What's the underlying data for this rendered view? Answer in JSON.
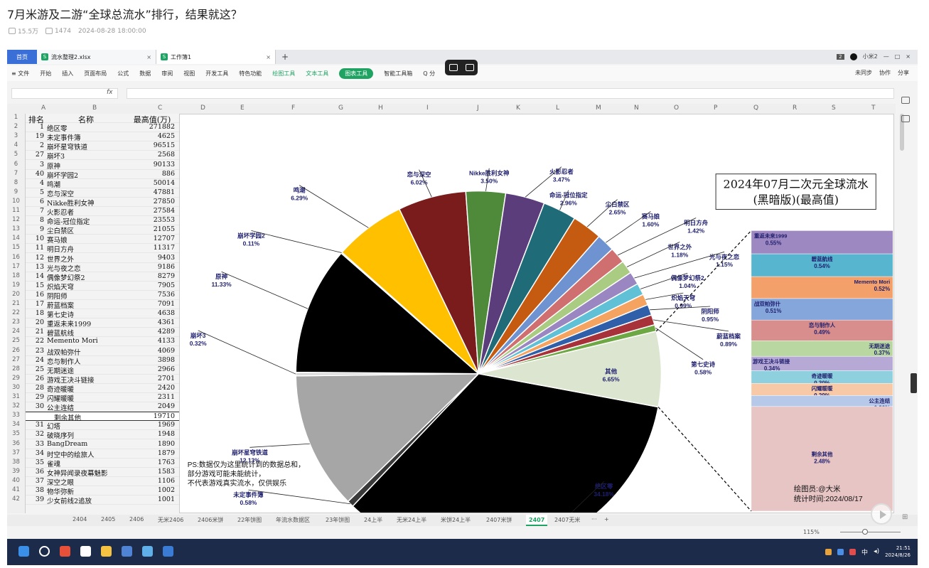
{
  "article": {
    "title": "7月米游及二游“全球总流水”排行，结果就这？",
    "views": "15.5万",
    "comments": "1474",
    "date": "2024-08-28 18:00:00"
  },
  "wps": {
    "home_tab": "首页",
    "doc_tabs": [
      {
        "label": "流水整理2.xlsx",
        "icon": "S"
      },
      {
        "label": "工作簿1",
        "icon": "S"
      }
    ],
    "user": "小米2",
    "page_badge": "2",
    "menu": [
      "≡ 文件",
      "开始",
      "插入",
      "页面布局",
      "公式",
      "数据",
      "审阅",
      "视图",
      "开发工具",
      "特色功能",
      "绘图工具",
      "文本工具",
      "图表工具",
      "智能工具箱",
      "Q 分"
    ],
    "ribbon_right": [
      "未同步",
      "协作",
      "分享"
    ],
    "fx": "fx"
  },
  "sheet": {
    "columns": [
      "A",
      "B",
      "C",
      "D",
      "E",
      "F",
      "G",
      "H",
      "I",
      "J",
      "K",
      "L",
      "M",
      "N",
      "O",
      "P",
      "Q",
      "R",
      "S",
      "T"
    ],
    "header": {
      "rank": "排名",
      "name": "名称",
      "value": "最高值(万)"
    },
    "rows": [
      {
        "rank": "1",
        "name": "绝区零",
        "value": "271882"
      },
      {
        "rank": "19",
        "name": "未定事件簿",
        "value": "4625"
      },
      {
        "rank": "2",
        "name": "崩坏星穹铁道",
        "value": "96515"
      },
      {
        "rank": "27",
        "name": "崩坏3",
        "value": "2568"
      },
      {
        "rank": "3",
        "name": "原神",
        "value": "90133"
      },
      {
        "rank": "40",
        "name": "崩坏学园2",
        "value": "886"
      },
      {
        "rank": "4",
        "name": "鸣潮",
        "value": "50014"
      },
      {
        "rank": "5",
        "name": "恋与深空",
        "value": "47881"
      },
      {
        "rank": "6",
        "name": "Nikke胜利女神",
        "value": "27850"
      },
      {
        "rank": "7",
        "name": "火影忍者",
        "value": "27584"
      },
      {
        "rank": "8",
        "name": "命运-冠位指定",
        "value": "23553"
      },
      {
        "rank": "9",
        "name": "尘白禁区",
        "value": "21055"
      },
      {
        "rank": "10",
        "name": "赛马娘",
        "value": "12707"
      },
      {
        "rank": "11",
        "name": "明日方舟",
        "value": "11317"
      },
      {
        "rank": "12",
        "name": "世界之外",
        "value": "9403"
      },
      {
        "rank": "13",
        "name": "光与夜之恋",
        "value": "9186"
      },
      {
        "rank": "14",
        "name": "偶像梦幻祭2",
        "value": "8279"
      },
      {
        "rank": "15",
        "name": "炽焰天穹",
        "value": "7905"
      },
      {
        "rank": "16",
        "name": "阴阳师",
        "value": "7536"
      },
      {
        "rank": "17",
        "name": "蔚蓝档案",
        "value": "7091"
      },
      {
        "rank": "18",
        "name": "第七史诗",
        "value": "4638"
      },
      {
        "rank": "20",
        "name": "重返未来1999",
        "value": "4361"
      },
      {
        "rank": "21",
        "name": "碧蓝航线",
        "value": "4289"
      },
      {
        "rank": "22",
        "name": "Memento Mori",
        "value": "4133"
      },
      {
        "rank": "23",
        "name": "战双帕弥什",
        "value": "4069"
      },
      {
        "rank": "24",
        "name": "恋与制作人",
        "value": "3898"
      },
      {
        "rank": "25",
        "name": "无期迷途",
        "value": "2966"
      },
      {
        "rank": "26",
        "name": "游戏王决斗链接",
        "value": "2701"
      },
      {
        "rank": "28",
        "name": "奇迹暖暖",
        "value": "2420"
      },
      {
        "rank": "29",
        "name": "闪耀暖暖",
        "value": "2311"
      },
      {
        "rank": "30",
        "name": "公主连结",
        "value": "2049"
      },
      {
        "rank": "",
        "name": "剩余其他",
        "value": "19710"
      },
      {
        "rank": "31",
        "name": "幻塔",
        "value": "1969"
      },
      {
        "rank": "32",
        "name": "破晓序列",
        "value": "1948"
      },
      {
        "rank": "33",
        "name": "BangDream",
        "value": "1890"
      },
      {
        "rank": "34",
        "name": "时空中的绘旅人",
        "value": "1879"
      },
      {
        "rank": "35",
        "name": "雀魂",
        "value": "1763"
      },
      {
        "rank": "36",
        "name": "女神异闻录夜幕魅影",
        "value": "1583"
      },
      {
        "rank": "37",
        "name": "深空之眼",
        "value": "1106"
      },
      {
        "rank": "38",
        "name": "物华弥新",
        "value": "1002"
      },
      {
        "rank": "39",
        "name": "少女前线2追放",
        "value": "1001"
      }
    ],
    "sheet_tabs": [
      "2404",
      "2405",
      "2406",
      "无米2406",
      "2406米饼",
      "22年饼图",
      "年流水数据区",
      "23年饼图",
      "24上半",
      "无米24上半",
      "米饼24上半",
      "2407米饼",
      "2407",
      "2407无米",
      "···",
      "+"
    ],
    "active_sheet": "2407",
    "zoom": "115%"
  },
  "chart_data": {
    "type": "pie",
    "title": "2024年07月二次元全球流水",
    "subtitle": "(黑暗版)(最高值)",
    "slices": [
      {
        "name": "绝区零",
        "pct": "34.18%",
        "value": 34.18,
        "color": "#000000"
      },
      {
        "name": "未定事件簿",
        "pct": "0.58%",
        "value": 0.58,
        "color": "#3a3a3a"
      },
      {
        "name": "崩坏星穹铁道",
        "pct": "12.13%",
        "value": 12.13,
        "color": "#a6a6a6"
      },
      {
        "name": "崩坏3",
        "pct": "0.32%",
        "value": 0.32,
        "color": "#dcdcdc"
      },
      {
        "name": "原神",
        "pct": "11.33%",
        "value": 11.33,
        "color": "#000000"
      },
      {
        "name": "崩坏学园2",
        "pct": "0.11%",
        "value": 0.11,
        "color": "#e4c200"
      },
      {
        "name": "鸣潮",
        "pct": "6.29%",
        "value": 6.29,
        "color": "#ffc000"
      },
      {
        "name": "恋与深空",
        "pct": "6.02%",
        "value": 6.02,
        "color": "#7b1c1c"
      },
      {
        "name": "Nikke胜利女神",
        "pct": "3.50%",
        "value": 3.5,
        "color": "#4e8a3a"
      },
      {
        "name": "火影忍者",
        "pct": "3.47%",
        "value": 3.47,
        "color": "#5a3d7a"
      },
      {
        "name": "命运-冠位指定",
        "pct": "2.96%",
        "value": 2.96,
        "color": "#1f6b78"
      },
      {
        "name": "尘白禁区",
        "pct": "2.65%",
        "value": 2.65,
        "color": "#c55a11"
      },
      {
        "name": "赛马娘",
        "pct": "1.60%",
        "value": 1.6,
        "color": "#6f93d0"
      },
      {
        "name": "明日方舟",
        "pct": "1.42%",
        "value": 1.42,
        "color": "#d06f6f"
      },
      {
        "name": "世界之外",
        "pct": "1.18%",
        "value": 1.18,
        "color": "#a9cb82"
      },
      {
        "name": "光与夜之恋",
        "pct": "1.15%",
        "value": 1.15,
        "color": "#9a86c1"
      },
      {
        "name": "偶像梦幻祭2",
        "pct": "1.04%",
        "value": 1.04,
        "color": "#5fc0d6"
      },
      {
        "name": "炽焰天穹",
        "pct": "0.99%",
        "value": 0.99,
        "color": "#f4a460"
      },
      {
        "name": "阴阳师",
        "pct": "0.95%",
        "value": 0.95,
        "color": "#2e5fa8"
      },
      {
        "name": "蔚蓝档案",
        "pct": "0.89%",
        "value": 0.89,
        "color": "#a8323a"
      },
      {
        "name": "第七史诗",
        "pct": "0.58%",
        "value": 0.58,
        "color": "#6ea844"
      },
      {
        "name": "其他",
        "pct": "6.65%",
        "value": 6.65,
        "color": "#dce5cf"
      }
    ],
    "breakout": [
      {
        "name": "重返未来1999",
        "pct": "0.55%",
        "value": 0.55,
        "color": "#9e88c2"
      },
      {
        "name": "碧蓝航线",
        "pct": "0.54%",
        "value": 0.54,
        "color": "#57b5cf"
      },
      {
        "name": "Memento Mori",
        "pct": "0.52%",
        "value": 0.52,
        "color": "#f4a06a"
      },
      {
        "name": "战双帕弥什",
        "pct": "0.51%",
        "value": 0.51,
        "color": "#84a6db"
      },
      {
        "name": "恋与制作人",
        "pct": "0.49%",
        "value": 0.49,
        "color": "#d98e8e"
      },
      {
        "name": "无期迷途",
        "pct": "0.37%",
        "value": 0.37,
        "color": "#b9d7a0"
      },
      {
        "name": "游戏王决斗链接",
        "pct": "0.34%",
        "value": 0.34,
        "color": "#b6a9d6"
      },
      {
        "name": "奇迹暖暖",
        "pct": "0.30%",
        "value": 0.3,
        "color": "#8fd0df"
      },
      {
        "name": "闪耀暖暖",
        "pct": "0.29%",
        "value": 0.29,
        "color": "#f7c9a6"
      },
      {
        "name": "公主连结",
        "pct": "0.26%",
        "value": 0.26,
        "color": "#b7c9e8"
      },
      {
        "name": "剩余其他",
        "pct": "2.48%",
        "value": 2.48,
        "color": "#e7c5c5"
      }
    ],
    "note": [
      "PS:数据仅为这里统计到的数据总和，",
      "部分游戏可能未能统计，",
      "不代表游戏真实流水，仅供娱乐"
    ],
    "author": "绘图员:@大米",
    "stat_time": "统计时间:2024/08/17"
  },
  "taskbar": {
    "time": "21:51",
    "date": "2024/8/26",
    "ime": "中"
  }
}
